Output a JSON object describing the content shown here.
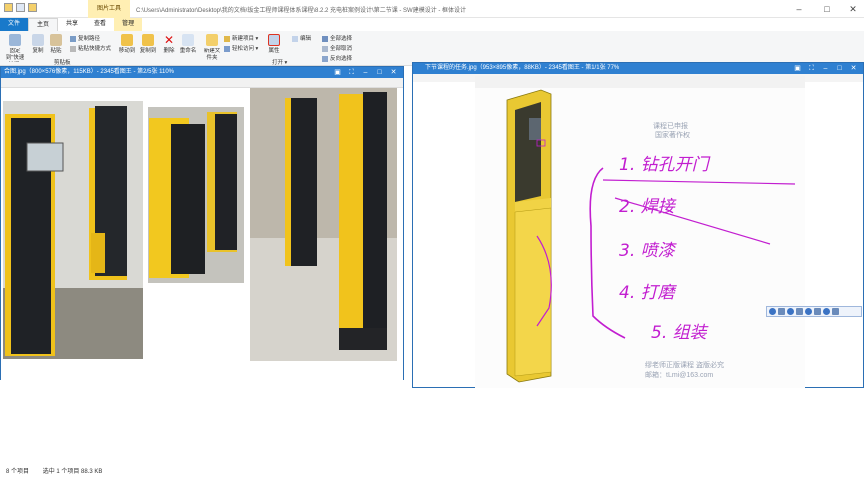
{
  "explorer": {
    "context_tab": "图片工具",
    "title_path": "C:\\Users\\Administrator\\Desktop\\我的文档\\钣金工程师课程体系课程\\8.2.2 充电桩案例设计\\第二节课 - SW建模设计 - 框体设计",
    "tabs": [
      "文件",
      "主页",
      "共享",
      "查看",
      "管理"
    ],
    "ribbon": {
      "pin_label": "固定到\"快速访问\"",
      "copy_label": "复制",
      "paste_label": "粘贴",
      "copy_path": "复制路径",
      "paste_shortcut": "粘贴快捷方式",
      "move_to": "移动到",
      "copy_to": "复制到",
      "delete": "删除",
      "rename": "重命名",
      "new_folder": "新建文件夹",
      "new_item": "新建项目",
      "easy_access": "轻松访问",
      "properties": "属性",
      "open": "打开",
      "edit": "编辑",
      "select_all": "全部选择",
      "select_none": "全部取消",
      "invert": "反向选择",
      "clipboard_group": "剪贴板"
    },
    "status": {
      "items": "8 个项目",
      "selected": "选中 1 个项目 88.3 KB"
    }
  },
  "viewer1": {
    "title": "合图.jpg（800×576像素，115KB）- 2345看图王 - 第2/5张 110%"
  },
  "viewer2": {
    "title": "下节课程的任务.jpg（953×895像素，88KB）- 2345看图王 - 第1/1张 77%",
    "watermark_top": [
      "课程已申报",
      "国家著作权"
    ],
    "watermark_bottom": [
      "缪老师正版课程 盗版必究",
      "邮箱：tLmi@163.com"
    ],
    "handwriting": [
      "1. 钻孔开门",
      "2. 焊接",
      "3. 喷漆",
      "4. 打磨",
      "5. 组装"
    ]
  },
  "colors": {
    "titlebar_blue": "#2f80d1",
    "file_tab": "#1979ca",
    "cabinet_yellow": "#f2c61c",
    "handwriting": "#c21ed0"
  }
}
